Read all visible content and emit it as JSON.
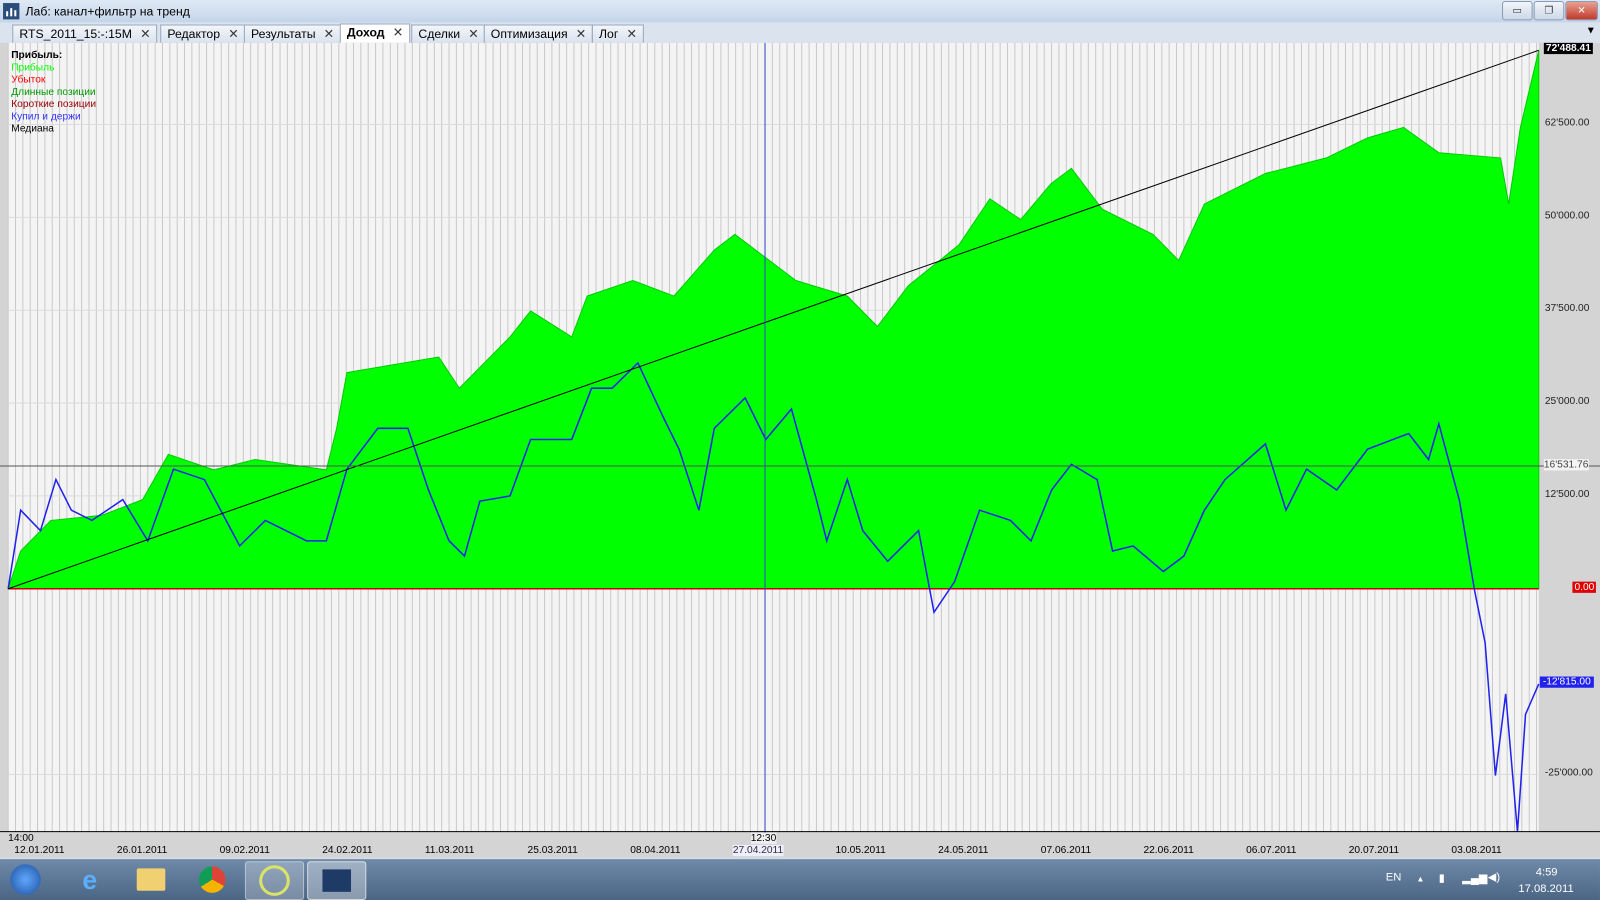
{
  "window": {
    "title": "Лаб: канал+фильтр на тренд",
    "minimize": "▭",
    "restore": "❐",
    "close": "✕"
  },
  "tabs": [
    {
      "label": "RTS_2011_15:-:15M"
    },
    {
      "label": "Редактор"
    },
    {
      "label": "Результаты"
    },
    {
      "label": "Доход",
      "active": true
    },
    {
      "label": "Сделки"
    },
    {
      "label": "Оптимизация"
    },
    {
      "label": "Лог"
    }
  ],
  "tab_close": "✕",
  "tab_menu": "▼",
  "legend": {
    "title": "Прибыль:",
    "items": [
      {
        "label": "Прибыль",
        "color": "#00ff00"
      },
      {
        "label": "Убыток",
        "color": "#ff0000"
      },
      {
        "label": "Длинные позиции",
        "color": "#009900"
      },
      {
        "label": "Короткие позиции",
        "color": "#990000"
      },
      {
        "label": "Купил и держи",
        "color": "#3333ff"
      },
      {
        "label": "Медиана",
        "color": "#000000"
      }
    ]
  },
  "chart_data": {
    "type": "area",
    "x_unit": "days since 12.01.2011",
    "xlim": [
      0,
      208.3
    ],
    "ylim": [
      -32700,
      76000
    ],
    "yticks": [
      62500,
      50000,
      37500,
      25000,
      12500,
      0,
      -25000
    ],
    "ytick_labels": [
      "62'500.00",
      "50'000.00",
      "37'500.00",
      "25'000.00",
      "12'500.00",
      "0.00",
      "-25'000.00"
    ],
    "xtick_labels": [
      "12.01.2011",
      "26.01.2011",
      "09.02.2011",
      "24.02.2011",
      "11.03.2011",
      "25.03.2011",
      "08.04.2011",
      "27.04.2011",
      "10.05.2011",
      "24.05.2011",
      "07.06.2011",
      "22.06.2011",
      "06.07.2011",
      "20.07.2011",
      "03.08.2011"
    ],
    "time_start": "14:00",
    "cursor": {
      "day": 103,
      "value": 16531.76,
      "time_label": "12:30",
      "date_label": "27.04.2011",
      "value_label": "16'531.76"
    },
    "last_profit_label": "72'488.41",
    "last_buyhold_label": "-12'815.00",
    "series": [
      {
        "name": "Прибыль",
        "color": "#00ff00",
        "points": [
          [
            0,
            0
          ],
          [
            1.7,
            5080
          ],
          [
            5.8,
            9200
          ],
          [
            12.8,
            9900
          ],
          [
            18.3,
            12000
          ],
          [
            21.8,
            18100
          ],
          [
            28,
            16000
          ],
          [
            33.6,
            17400
          ],
          [
            43.3,
            16000
          ],
          [
            44.7,
            21600
          ],
          [
            46.1,
            29100
          ],
          [
            54.4,
            30500
          ],
          [
            58.6,
            31200
          ],
          [
            61.4,
            27000
          ],
          [
            68.3,
            33900
          ],
          [
            71.1,
            37400
          ],
          [
            76.7,
            33900
          ],
          [
            78.8,
            39400
          ],
          [
            85,
            41500
          ],
          [
            90.6,
            39400
          ],
          [
            96.1,
            45600
          ],
          [
            98.9,
            47700
          ],
          [
            107.2,
            41500
          ],
          [
            114.2,
            39400
          ],
          [
            118.3,
            35300
          ],
          [
            122.5,
            40800
          ],
          [
            129.4,
            46300
          ],
          [
            133.6,
            52500
          ],
          [
            137.8,
            49700
          ],
          [
            141.9,
            54500
          ],
          [
            144.7,
            56600
          ],
          [
            148.9,
            51100
          ],
          [
            155.8,
            47700
          ],
          [
            159.3,
            44200
          ],
          [
            162.8,
            51800
          ],
          [
            171.1,
            55900
          ],
          [
            179.4,
            58000
          ],
          [
            185,
            60700
          ],
          [
            189.9,
            62100
          ],
          [
            194.7,
            58700
          ],
          [
            203.1,
            58000
          ],
          [
            204.2,
            51800
          ],
          [
            205.8,
            62100
          ],
          [
            208.3,
            72488
          ]
        ]
      },
      {
        "name": "Купил и держи",
        "color": "#2222ee",
        "points": [
          [
            0,
            0
          ],
          [
            1.7,
            10580
          ],
          [
            4.4,
            7830
          ],
          [
            6.5,
            14700
          ],
          [
            8.6,
            10580
          ],
          [
            11.4,
            9200
          ],
          [
            15.6,
            12000
          ],
          [
            19,
            6450
          ],
          [
            22.5,
            16100
          ],
          [
            26.7,
            14700
          ],
          [
            31.5,
            5770
          ],
          [
            35,
            9200
          ],
          [
            40.6,
            6450
          ],
          [
            43.3,
            6450
          ],
          [
            46.1,
            16100
          ],
          [
            50.3,
            21600
          ],
          [
            54.4,
            21600
          ],
          [
            57.2,
            13300
          ],
          [
            60,
            6450
          ],
          [
            62.1,
            4400
          ],
          [
            64.2,
            11800
          ],
          [
            68.3,
            12500
          ],
          [
            71.1,
            20100
          ],
          [
            76.7,
            20100
          ],
          [
            79.4,
            27000
          ],
          [
            82.2,
            27000
          ],
          [
            85.7,
            30400
          ],
          [
            89.2,
            23000
          ],
          [
            91.3,
            18800
          ],
          [
            94,
            10580
          ],
          [
            96.1,
            21600
          ],
          [
            100.3,
            25700
          ],
          [
            103.1,
            20100
          ],
          [
            106.6,
            24200
          ],
          [
            110,
            12000
          ],
          [
            111.4,
            6450
          ],
          [
            114.2,
            14700
          ],
          [
            116.3,
            7830
          ],
          [
            119.7,
            3710
          ],
          [
            123.9,
            7830
          ],
          [
            126,
            -3160
          ],
          [
            128.8,
            960
          ],
          [
            132.2,
            10580
          ],
          [
            136.4,
            9200
          ],
          [
            139.2,
            6450
          ],
          [
            142,
            13300
          ],
          [
            144.7,
            16750
          ],
          [
            148.2,
            14700
          ],
          [
            150.3,
            5080
          ],
          [
            153.1,
            5770
          ],
          [
            157.2,
            2330
          ],
          [
            160,
            4400
          ],
          [
            162.8,
            10580
          ],
          [
            165.6,
            14700
          ],
          [
            171.1,
            19500
          ],
          [
            173.9,
            10580
          ],
          [
            176.7,
            16100
          ],
          [
            180.8,
            13300
          ],
          [
            185,
            18800
          ],
          [
            190.6,
            20900
          ],
          [
            193.3,
            17400
          ],
          [
            194.7,
            22200
          ],
          [
            197.5,
            11900
          ],
          [
            199.6,
            -410
          ],
          [
            201,
            -7280
          ],
          [
            202.4,
            -25140
          ],
          [
            203.8,
            -14150
          ],
          [
            205.4,
            -32700
          ],
          [
            206.5,
            -16900
          ],
          [
            208.3,
            -12815
          ]
        ]
      },
      {
        "name": "Медиана",
        "color": "#000000",
        "points": [
          [
            0,
            0
          ],
          [
            208.3,
            72488
          ]
        ]
      }
    ]
  },
  "taskbar": {
    "lang": "EN",
    "time": "4:59",
    "date": "17.08.2011",
    "tray_arrow": "▲"
  }
}
